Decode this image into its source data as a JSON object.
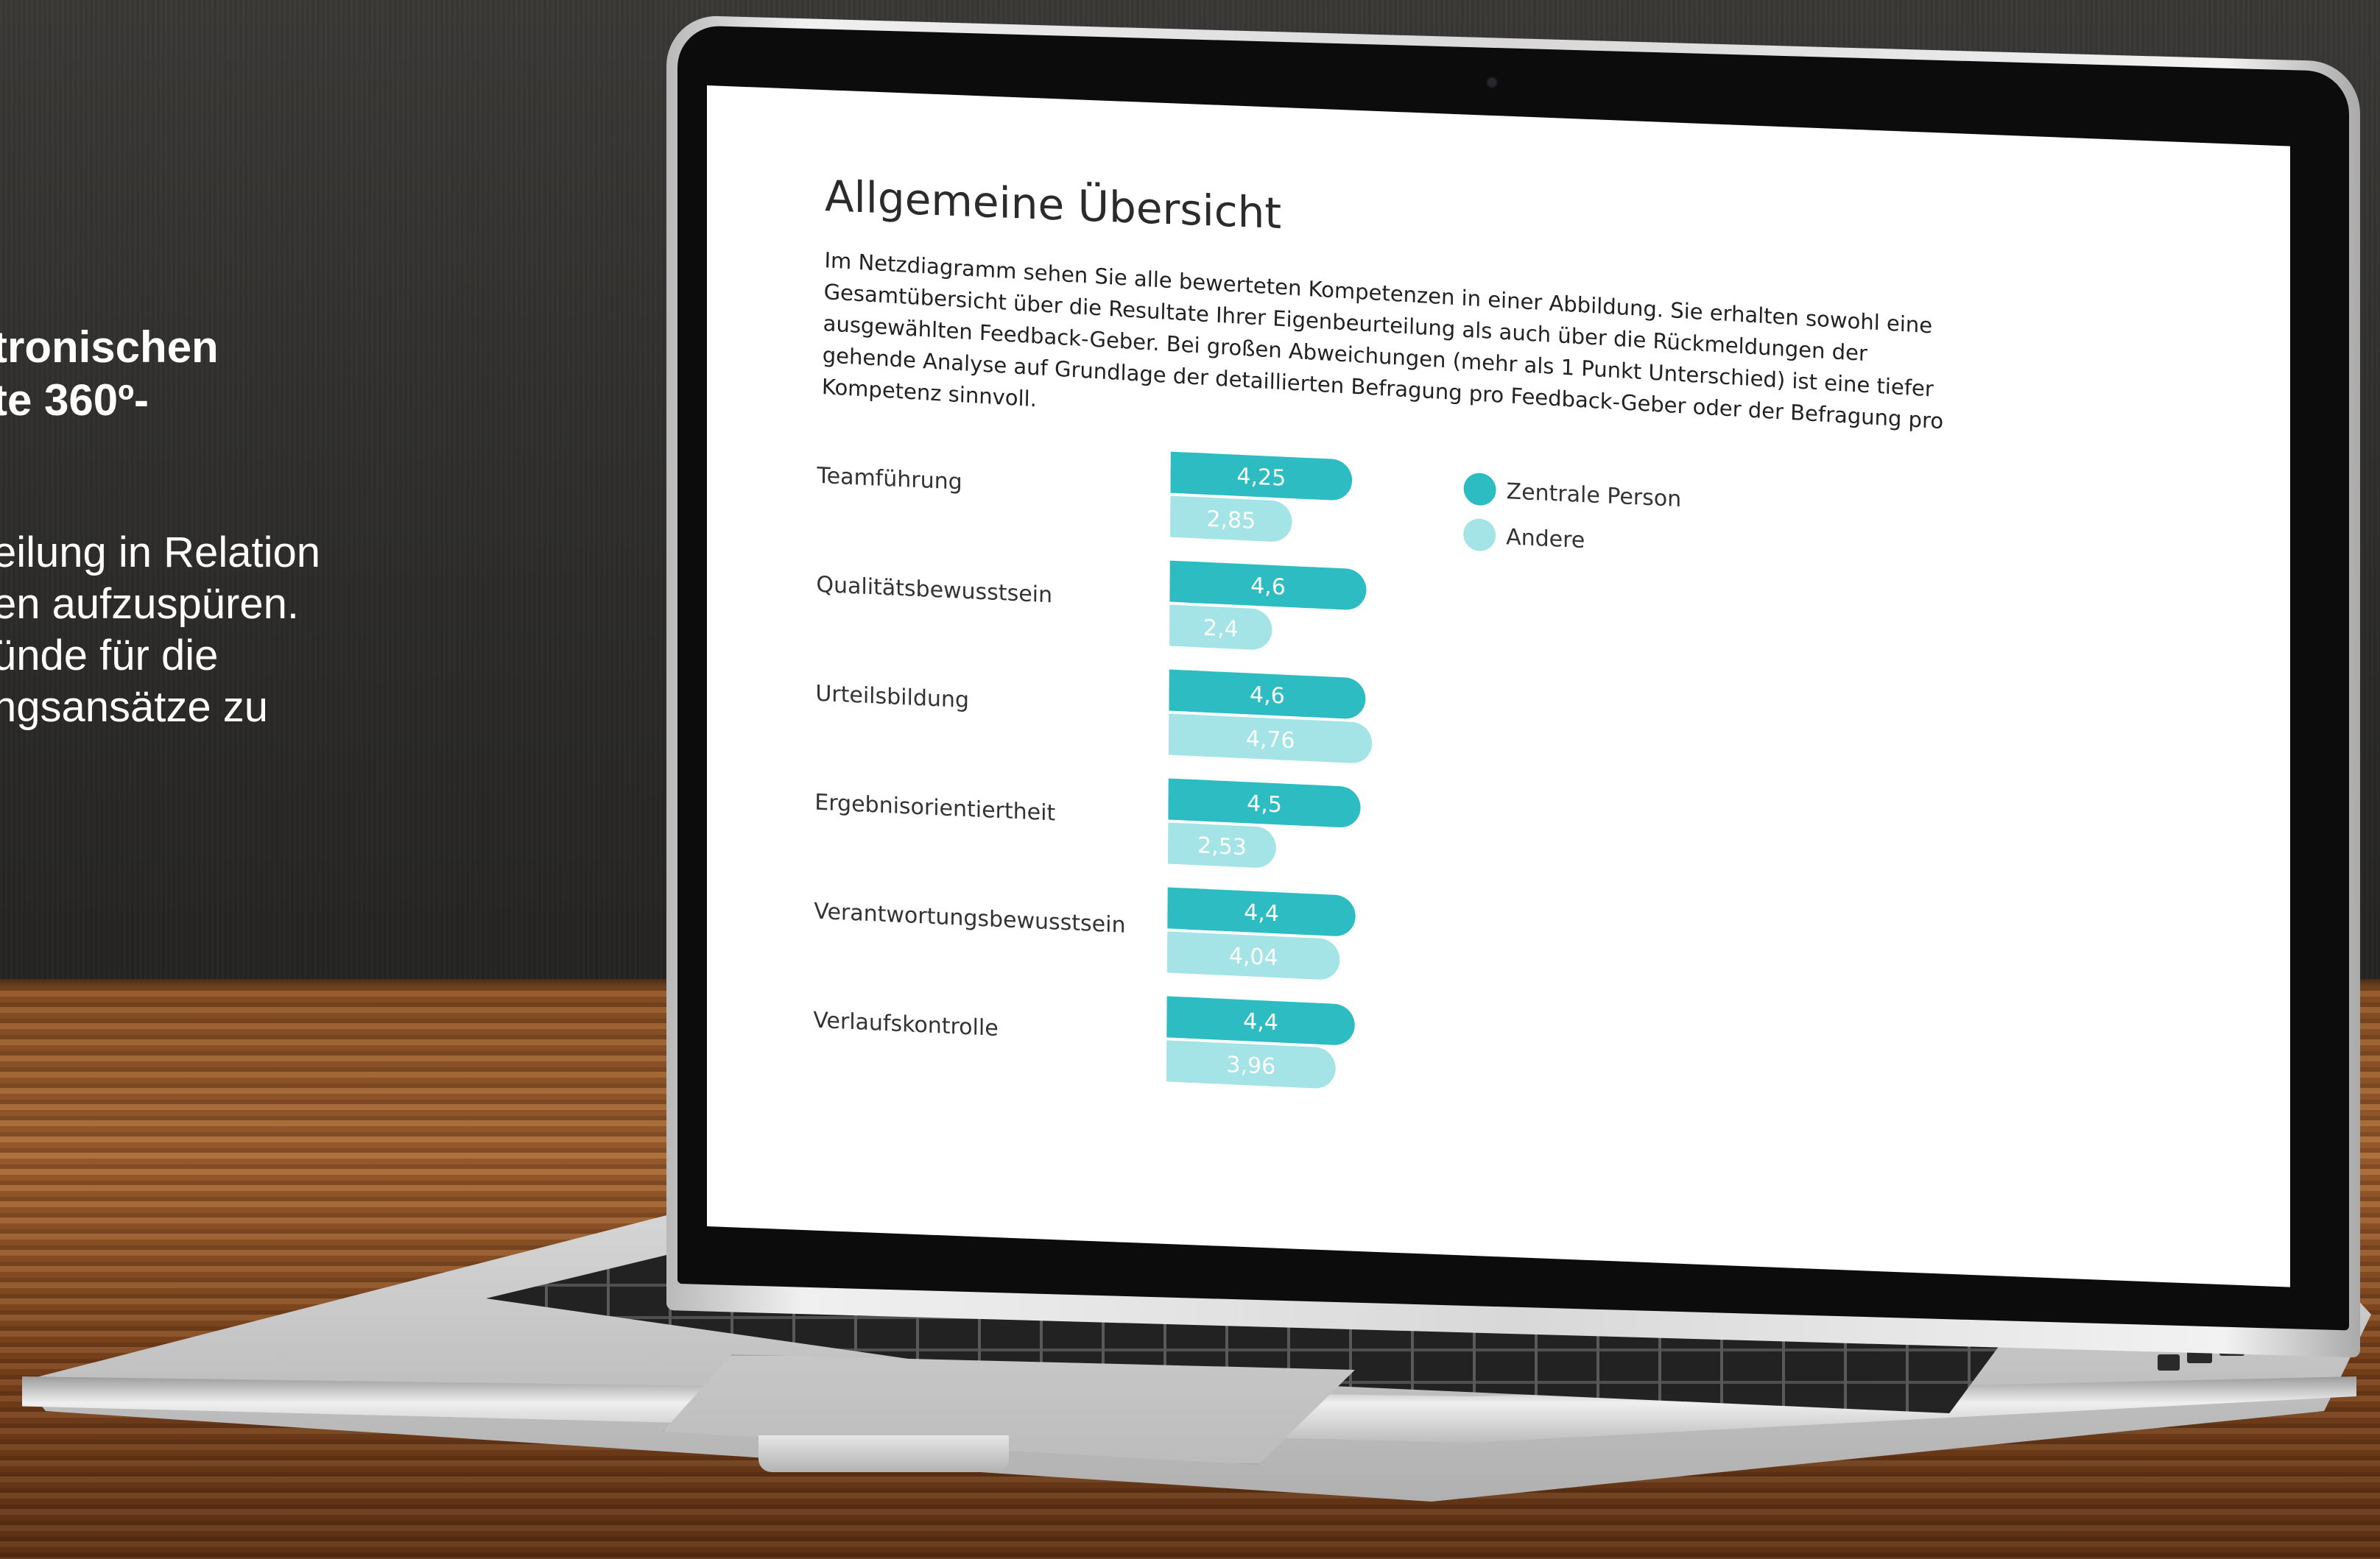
{
  "side_text": {
    "bold_lines": [
      "tronischen",
      "te 360º-"
    ],
    "lines": [
      "eilung in Relation",
      "en aufzuspüren.",
      "ünde für die",
      "ngsansätze zu"
    ]
  },
  "report": {
    "title": "Allgemeine Übersicht",
    "description": "Im Netzdiagramm sehen Sie alle bewerteten Kompetenzen in einer Abbildung. Sie erhalten sowohl eine Gesamtübersicht über die Resultate Ihrer Eigenbeurteilung als auch über die Rückmeldungen der ausgewählten Feedback-Geber. Bei großen Abweichungen (mehr als 1 Punkt Unterschied) ist eine tiefer gehende Analyse auf Grundlage der detaillierten Befragung pro Feedback-Geber oder der Befragung pro Kompetenz sinnvoll."
  },
  "chart_data": {
    "type": "bar",
    "orientation": "horizontal",
    "categories": [
      "Teamführung",
      "Qualitätsbewusstsein",
      "Urteilsbildung",
      "Ergebnisorientiertheit",
      "Verantwortungsbewusstsein",
      "Verlaufskontrolle"
    ],
    "series": [
      {
        "name": "Zentrale Person",
        "values": [
          4.25,
          4.6,
          4.6,
          4.5,
          4.4,
          4.4
        ],
        "labels": [
          "4,25",
          "4,6",
          "4,6",
          "4,5",
          "4,4",
          "4,4"
        ],
        "color": "#2cbcc2"
      },
      {
        "name": "Andere",
        "values": [
          2.85,
          2.4,
          4.76,
          2.53,
          4.04,
          3.96
        ],
        "labels": [
          "2,85",
          "2,4",
          "4,76",
          "2,53",
          "4,04",
          "3,96"
        ],
        "color": "#a4e4e6"
      }
    ],
    "xlim": [
      0,
      5
    ],
    "legend": "right",
    "grid": false
  }
}
